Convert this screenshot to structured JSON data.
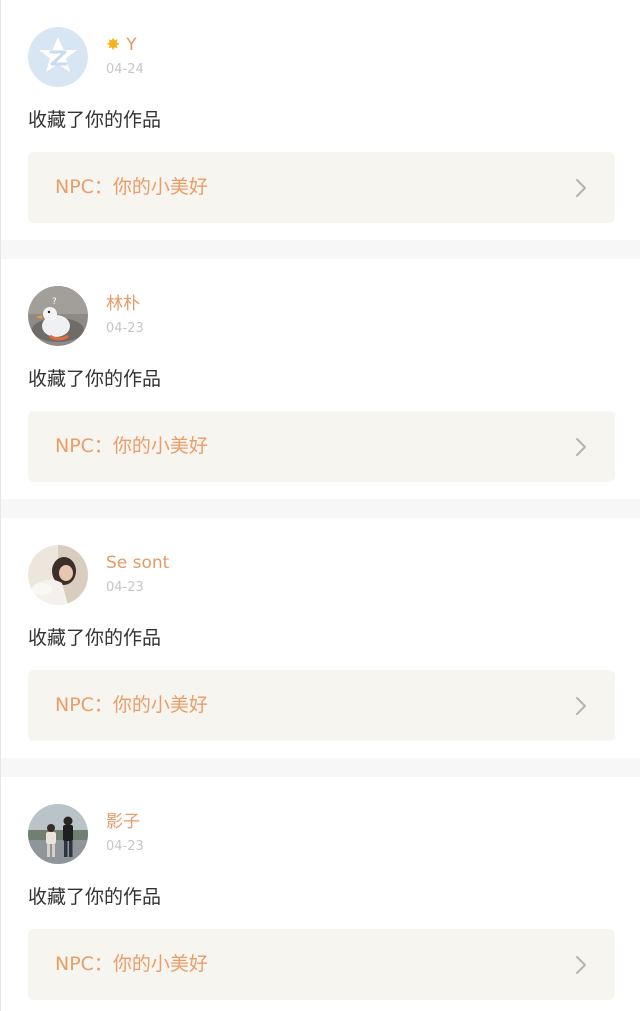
{
  "feed": {
    "items": [
      {
        "user_name": "Y",
        "name_prefix_icon": "sun-icon",
        "date": "04-24",
        "action": "收藏了你的作品",
        "work_title": "NPC：你的小美好",
        "avatar": "default-z-avatar"
      },
      {
        "user_name": "林朴",
        "date": "04-23",
        "action": "收藏了你的作品",
        "work_title": "NPC：你的小美好",
        "avatar": "duck-avatar"
      },
      {
        "user_name": "Se sont",
        "date": "04-23",
        "action": "收藏了你的作品",
        "work_title": "NPC：你的小美好",
        "avatar": "girl-photo-avatar"
      },
      {
        "user_name": "影子",
        "date": "04-23",
        "action": "收藏了你的作品",
        "work_title": "NPC：你的小美好",
        "avatar": "couple-photo-avatar"
      }
    ]
  },
  "colors": {
    "name": "#e59a67",
    "date": "#c6c6c6",
    "action_text": "#333333",
    "work_title": "#ea9d68",
    "work_box_bg": "#f6f5ef",
    "divider": "#f8f7f7",
    "chevron": "#b3b3b3"
  }
}
